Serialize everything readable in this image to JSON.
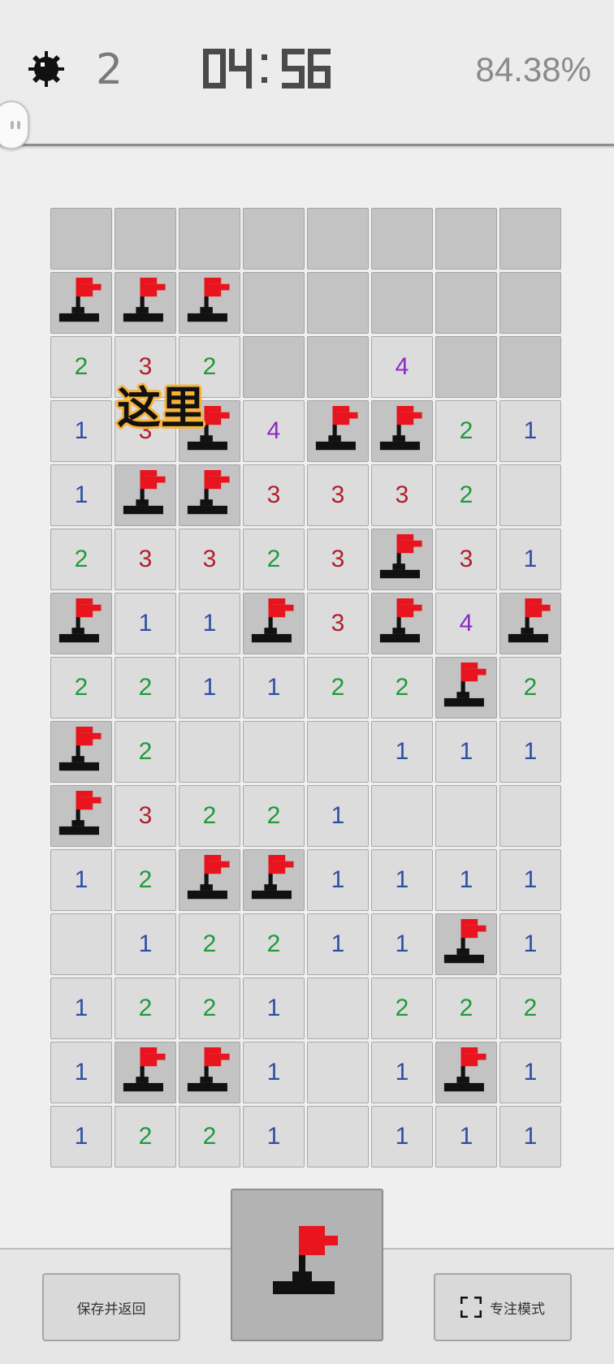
{
  "header": {
    "mine_icon": "mine-icon",
    "mines_remaining": "2",
    "timer": "04:56",
    "timer_digits": [
      "0",
      "4",
      ":",
      "5",
      "6"
    ],
    "progress": "84.38%"
  },
  "hint_label": "这里",
  "board": {
    "columns": 8,
    "rows": 15,
    "legend": "H = hidden, F = flag, E = empty opened, digit = opened number",
    "cells": [
      [
        "H",
        "H",
        "H",
        "H",
        "H",
        "H",
        "H",
        "H"
      ],
      [
        "F",
        "F",
        "F",
        "H",
        "H",
        "H",
        "H",
        "H"
      ],
      [
        "2",
        "3",
        "2",
        "H",
        "H",
        "4",
        "H",
        "H"
      ],
      [
        "1",
        "3",
        "F",
        "4",
        "F",
        "F",
        "2",
        "1"
      ],
      [
        "1",
        "F",
        "F",
        "3",
        "3",
        "3",
        "2",
        "E"
      ],
      [
        "2",
        "3",
        "3",
        "2",
        "3",
        "F",
        "3",
        "1"
      ],
      [
        "F",
        "1",
        "1",
        "F",
        "3",
        "F",
        "4",
        "F"
      ],
      [
        "2",
        "2",
        "1",
        "1",
        "2",
        "2",
        "F",
        "2"
      ],
      [
        "F",
        "2",
        "E",
        "E",
        "E",
        "1",
        "1",
        "1"
      ],
      [
        "F",
        "3",
        "2",
        "2",
        "1",
        "E",
        "E",
        "E"
      ],
      [
        "1",
        "2",
        "F",
        "F",
        "1",
        "1",
        "1",
        "1"
      ],
      [
        "E",
        "1",
        "2",
        "2",
        "1",
        "1",
        "F",
        "1"
      ],
      [
        "1",
        "2",
        "2",
        "1",
        "E",
        "2",
        "2",
        "2"
      ],
      [
        "1",
        "F",
        "F",
        "1",
        "E",
        "1",
        "F",
        "1"
      ],
      [
        "1",
        "2",
        "2",
        "1",
        "E",
        "1",
        "1",
        "1"
      ]
    ]
  },
  "colors": {
    "n1": "#2d4fa8",
    "n2": "#1e9b3a",
    "n3": "#b0202a",
    "n4": "#8b2bc2",
    "flag_red": "#e8141e",
    "hint_outline": "#f6b23a"
  },
  "bottom": {
    "save_label": "保存并返回",
    "focus_label": "专注模式",
    "focus_icon": "expand-corners-icon",
    "mode_icon": "flag-icon"
  }
}
